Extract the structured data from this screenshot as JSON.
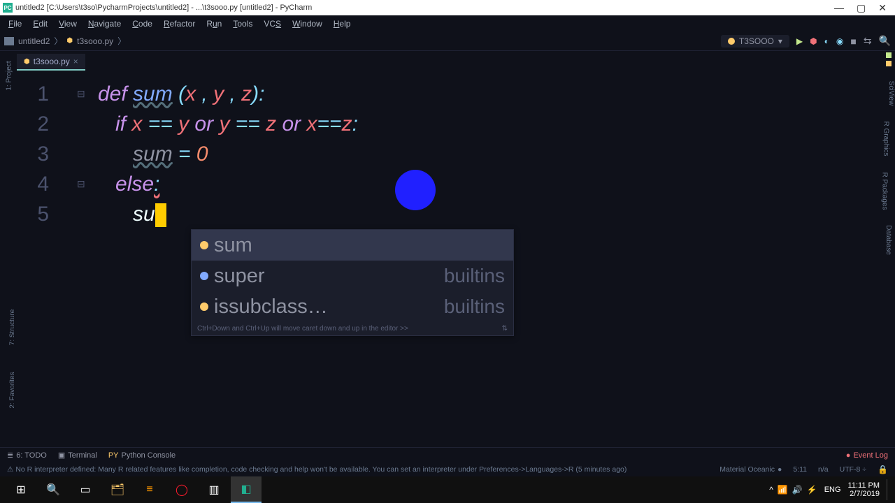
{
  "window": {
    "title": "untitled2 [C:\\Users\\t3so\\PycharmProjects\\untitled2] - ...\\t3sooo.py [untitled2] - PyCharm",
    "min": "—",
    "max": "▢",
    "close": "✕"
  },
  "menu": [
    "File",
    "Edit",
    "View",
    "Navigate",
    "Code",
    "Refactor",
    "Run",
    "Tools",
    "VCS",
    "Window",
    "Help"
  ],
  "breadcrumb": {
    "project": "untitled2",
    "file": "t3sooo.py",
    "sep": "〉"
  },
  "runconf": {
    "name": "T3SOOO",
    "arrow": "▾"
  },
  "tab": {
    "name": "t3sooo.py",
    "close": "×"
  },
  "lines": [
    "1",
    "2",
    "3",
    "4",
    "5"
  ],
  "code": {
    "l1": {
      "def": "def ",
      "fn": "sum",
      "rest": " (x , y , z):"
    },
    "l2": {
      "if": "if ",
      "body": "x == y ",
      "or1": "or ",
      "b2": "y == z ",
      "or2": "or ",
      "b3": "x==z",
      ":": ":"
    },
    "l3": {
      "sum": "sum",
      "eq": " = ",
      "zero": "0"
    },
    "l4": {
      "else": "else",
      ":": ":"
    },
    "l5": {
      "typed": "su"
    }
  },
  "autocomplete": {
    "items": [
      {
        "name": "sum",
        "module": "",
        "sel": true,
        "dot": "#ffcb6b"
      },
      {
        "name": "super",
        "module": "builtins",
        "sel": false,
        "dot": "#82aaff"
      },
      {
        "name": "issubclass…",
        "module": "builtins",
        "sel": false,
        "dot": "#ffcb6b"
      }
    ],
    "hint": "Ctrl+Down and Ctrl+Up will move caret down and up in the editor  >>"
  },
  "leftTools": [
    "1: Project",
    "7: Structure",
    "2: Favorites"
  ],
  "rightTools": [
    "SciView",
    "R Graphics",
    "R Packages",
    "Database"
  ],
  "bottom": {
    "todo": "6: TODO",
    "term": "Terminal",
    "pycon": "Python Console",
    "eventlog": "Event Log"
  },
  "status": {
    "msg": "No R interpreter defined: Many R related features like completion, code checking and help won't be available. You can set an interpreter under Preferences->Languages->R (5 minutes ago)",
    "theme": "Material Oceanic",
    "pos": "5:11",
    "na": "n/a",
    "enc": "UTF-8",
    "lock": "🔒"
  },
  "taskbar": {
    "tray": [
      "^",
      "📶",
      "🔊",
      "⚡"
    ],
    "lang": "ENG",
    "time": "11:11 PM",
    "date": "2/7/2019"
  }
}
